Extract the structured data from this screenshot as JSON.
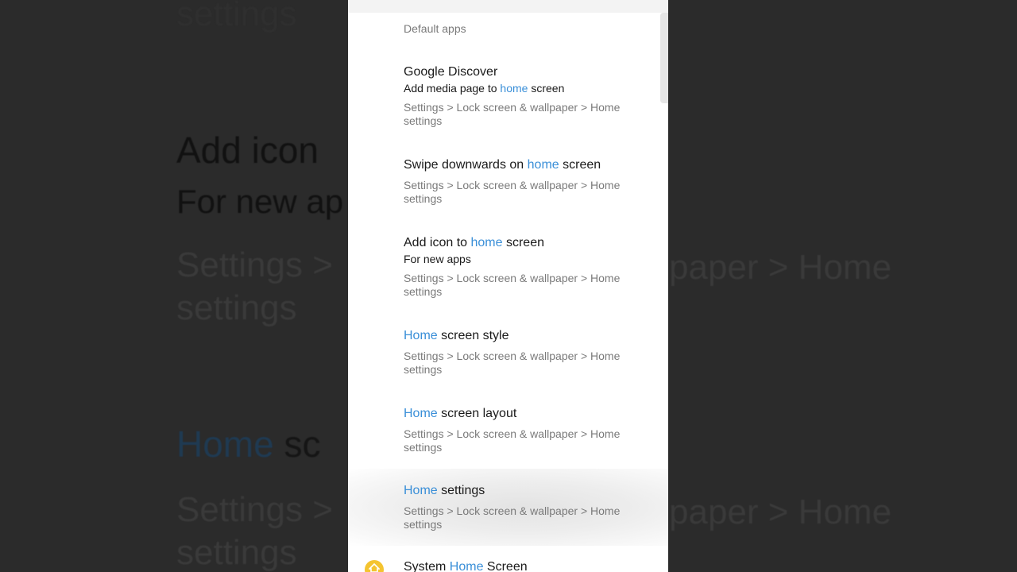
{
  "background": {
    "line1": "settings",
    "add_icon": "Add icon",
    "for_new_apps": "For new ap",
    "settings_path_left": "Settings >",
    "settings_path_right": "paper > Home",
    "settings_word": "settings",
    "home_hl": "Home",
    "home_rest": " sc",
    "settings_path_left2": "Settings >",
    "settings_path_right2": "paper > Home",
    "settings_word2": "settings"
  },
  "results": [
    {
      "title_partial": "Default apps",
      "path": "Default apps"
    },
    {
      "title": "Google Discover",
      "summary_pre": "Add media page to ",
      "summary_hl": "home",
      "summary_post": " screen",
      "path": "Settings > Lock screen & wallpaper > Home settings"
    },
    {
      "title_pre": "Swipe downwards on ",
      "title_hl": "home",
      "title_post": " screen",
      "path": "Settings > Lock screen & wallpaper > Home settings"
    },
    {
      "title_pre": "Add icon to ",
      "title_hl": "home",
      "title_post": " screen",
      "summary": "For new apps",
      "path": "Settings > Lock screen & wallpaper > Home settings"
    },
    {
      "title_hl": "Home",
      "title_post": " screen style",
      "path": "Settings > Lock screen & wallpaper > Home settings"
    },
    {
      "title_hl": "Home",
      "title_post": " screen layout",
      "path": "Settings > Lock screen & wallpaper > Home settings"
    },
    {
      "title_hl": "Home",
      "title_post": " settings",
      "path": "Settings > Lock screen & wallpaper > Home settings"
    },
    {
      "title_pre": "System ",
      "title_hl": "Home",
      "title_post": " Screen",
      "icon": "home-app-icon"
    }
  ],
  "colors": {
    "highlight": "#3a8fd8",
    "path_text": "#7a7a7a",
    "primary_text": "#1a1a1a"
  }
}
